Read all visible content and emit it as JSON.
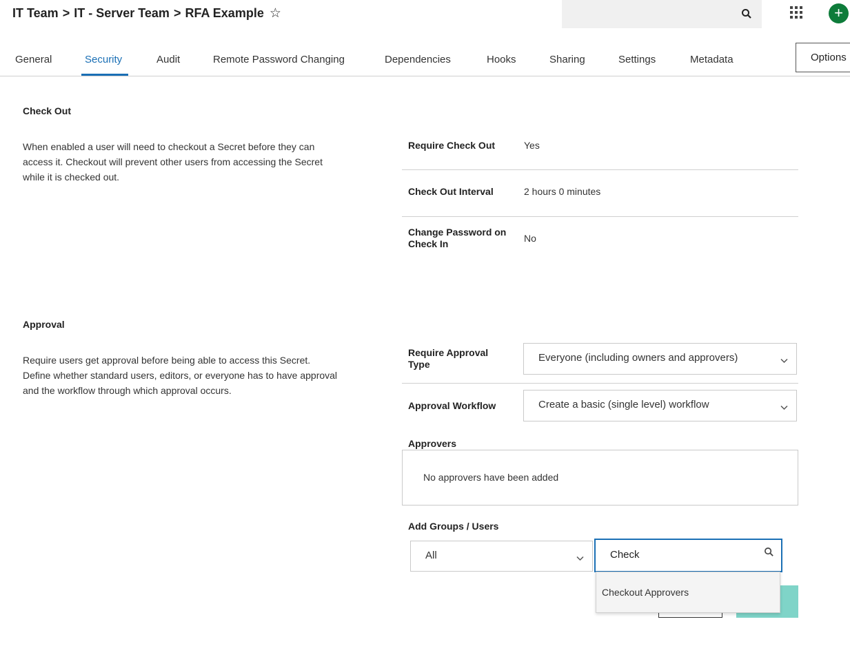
{
  "header": {
    "breadcrumb": [
      "IT Team",
      "IT - Server Team",
      "RFA Example"
    ],
    "separator": ">",
    "favorite_icon": "star-outline-icon",
    "search_icon": "search-icon",
    "apps_icon": "grid-icon",
    "add_icon": "plus-icon",
    "add_color": "#0e7c3a"
  },
  "tabs": {
    "items": [
      "General",
      "Security",
      "Audit",
      "Remote Password Changing",
      "Dependencies",
      "Hooks",
      "Sharing",
      "Settings",
      "Metadata"
    ],
    "active": "Security",
    "active_color": "#1a6fb5",
    "options_label": "Options"
  },
  "checkout": {
    "title": "Check Out",
    "description": "When enabled a user will need to checkout a Secret before they can access it. Checkout will prevent other users from accessing the Secret while it is checked out.",
    "fields": [
      {
        "label": "Require Check Out",
        "value": "Yes"
      },
      {
        "label": "Check Out Interval",
        "value": "2 hours 0 minutes"
      },
      {
        "label": "Change Password on Check In",
        "value": "No"
      }
    ]
  },
  "approval": {
    "title": "Approval",
    "description": "Require users get approval before being able to access this Secret. Define whether standard users, editors, or everyone has to have approval and the workflow through which approval occurs.",
    "require_type_label": "Require Approval Type",
    "require_type_value": "Everyone (including owners and approvers)",
    "workflow_label": "Approval Workflow",
    "workflow_value": "Create a basic (single level) workflow",
    "approvers_label": "Approvers",
    "approvers_empty": "No approvers have been added",
    "add_label": "Add Groups / Users",
    "filter_value": "All",
    "search_value": "Check",
    "suggestion": "Checkout Approvers",
    "accent_color": "#7fd4c8"
  }
}
